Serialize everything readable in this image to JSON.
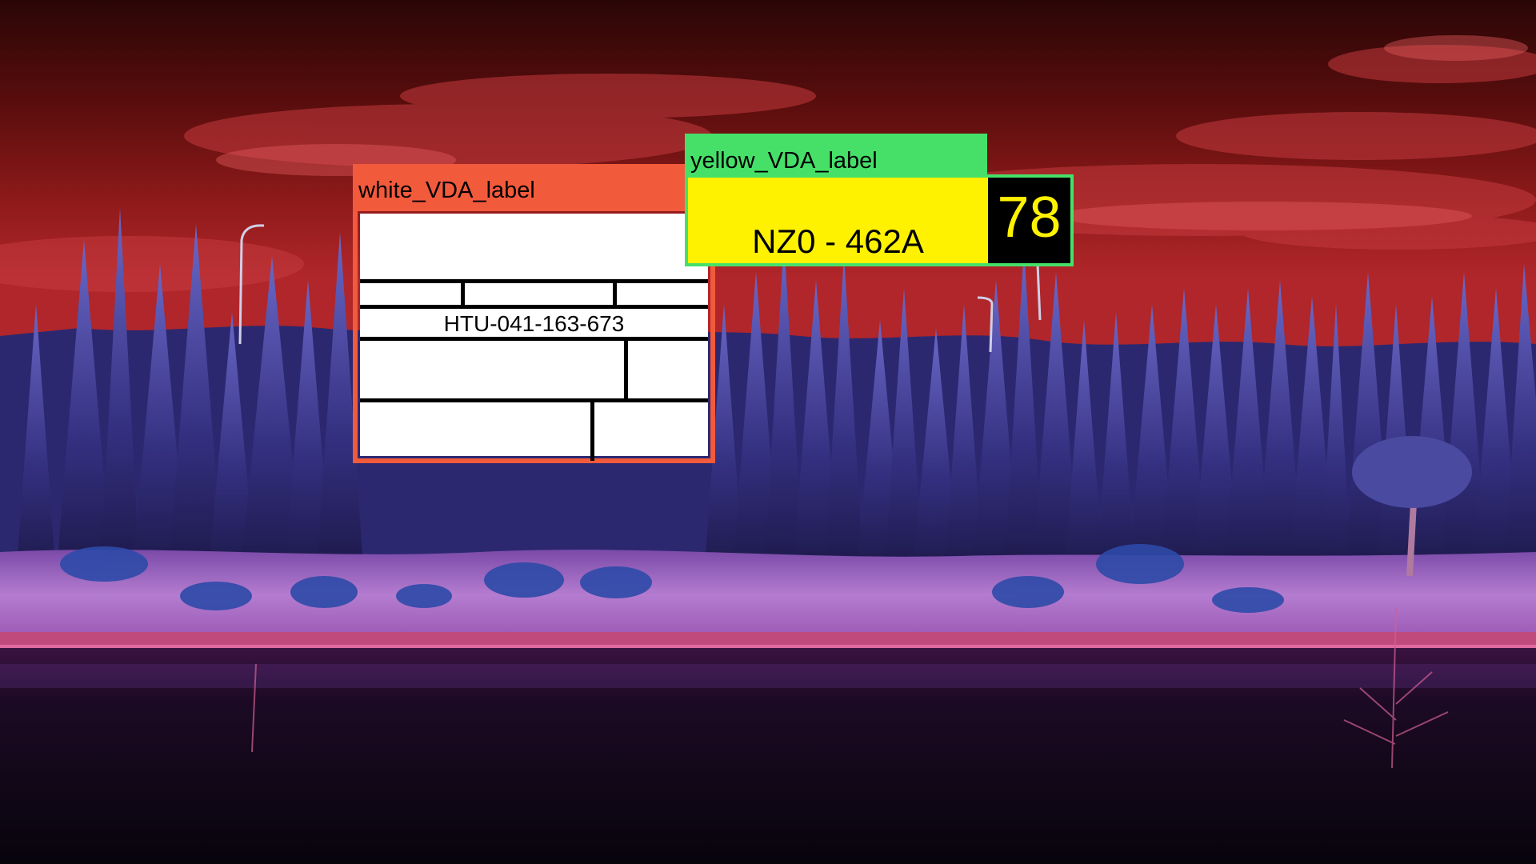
{
  "background": {
    "description_icon": "infrared-landscape-image",
    "sky_color": "#8a1616",
    "tree_color": "#3a3a8c",
    "ground_color": "#b070c8",
    "water_color": "#120818"
  },
  "annotations": {
    "white_label": {
      "header": "white_VDA_label",
      "header_color": "#f25a3c",
      "id_text": "HTU-041-163-673"
    },
    "yellow_label": {
      "header": "yellow_VDA_label",
      "header_color": "#46e068",
      "plate_text": "NZ0 - 462A",
      "number": "78",
      "plate_color": "#fff200"
    }
  }
}
